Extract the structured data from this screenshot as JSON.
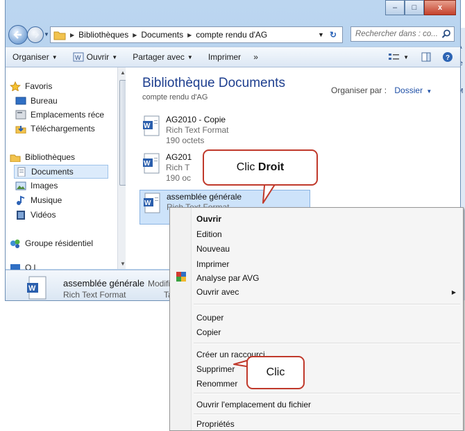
{
  "window": {
    "caption_buttons": {
      "minimize": "–",
      "maximize": "□",
      "close": "x"
    },
    "breadcrumb": [
      "Bibliothèques",
      "Documents",
      "compte rendu d'AG"
    ],
    "refresh_glyph": "↻",
    "search_placeholder": "Rechercher dans : co..."
  },
  "toolbar": {
    "organize": "Organiser",
    "open": "Ouvrir",
    "share": "Partager avec",
    "print": "Imprimer",
    "more": "»"
  },
  "navpane": {
    "favorites": "Favoris",
    "desktop": "Bureau",
    "recent": "Emplacements réce",
    "downloads": "Téléchargements",
    "libraries": "Bibliothèques",
    "documents": "Documents",
    "images": "Images",
    "music": "Musique",
    "videos": "Vidéos",
    "homegroup": "Groupe résidentiel",
    "computer_partial": "O    l"
  },
  "content": {
    "title": "Bibliothèque Documents",
    "subtitle": "compte rendu d'AG",
    "arrange_label": "Organiser par :",
    "arrange_value": "Dossier",
    "files": [
      {
        "name": "AG2010 - Copie",
        "type": "Rich Text Format",
        "size": "190 octets"
      },
      {
        "name": "AG201",
        "type": "Rich T",
        "size": "190 oc"
      },
      {
        "name": "assemblée générale",
        "type": "Rich Text Format",
        "size": ""
      }
    ]
  },
  "details": {
    "name": "assemblée générale",
    "modified_label": "Modifi",
    "type": "Rich Text Format",
    "partial": "Ta"
  },
  "callouts": {
    "right_click_prefix": "Clic",
    "right_click_bold": "Droit",
    "click": "Clic"
  },
  "context_menu": {
    "open": "Ouvrir",
    "edit": "Edition",
    "new": "Nouveau",
    "print": "Imprimer",
    "scan": "Analyse par AVG",
    "open_with": "Ouvrir avec",
    "cut": "Couper",
    "copy": "Copier",
    "shortcut": "Créer un raccourci",
    "delete": "Supprimer",
    "rename": "Renommer",
    "open_location": "Ouvrir l'emplacement du fichier",
    "properties": "Propriétés"
  }
}
